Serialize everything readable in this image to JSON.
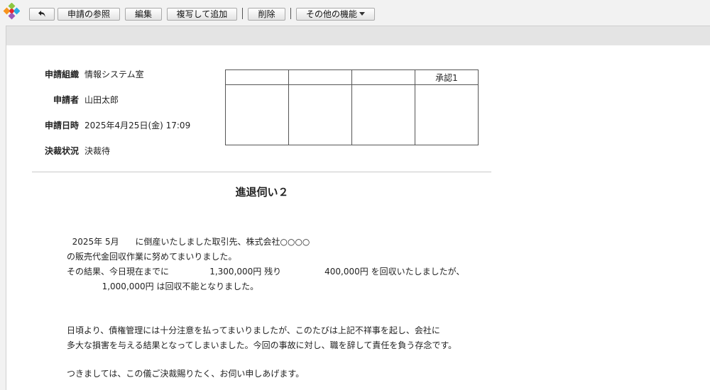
{
  "toolbar": {
    "buttons": {
      "reference": "申請の参照",
      "edit": "編集",
      "duplicate": "複写して追加",
      "delete": "削除",
      "other": "その他の機能"
    }
  },
  "application": {
    "fields": [
      {
        "label": "申請組織",
        "value": "情報システム室"
      },
      {
        "label": "申請者",
        "value": "山田太郎"
      },
      {
        "label": "申請日時",
        "value": "2025年4月25日(金) 17:09"
      },
      {
        "label": "決裁状況",
        "value": "決裁待"
      }
    ]
  },
  "approval_table": {
    "headers": [
      "",
      "",
      "",
      "承認1"
    ]
  },
  "document": {
    "title": "進退伺い２",
    "paragraph1": [
      "  2025年 5月      に倒産いたしました取引先、株式会社○○○○",
      "の販売代金回収作業に努めてまいりました。",
      "その結果、今日現在までに               1,300,000円 残り                400,000円 を回収いたしましたが、",
      "             1,000,000円 は回収不能となりました。"
    ],
    "paragraph2": [
      "日頃より、債権管理には十分注意を払ってまいりましたが、このたびは上記不祥事を起し、会社に",
      "多大な損害を与える結果となってしまいました。今回の事故に対し、職を辞して責任を負う存念です。"
    ],
    "paragraph3": "つきましては、この儀ご決裁賜りたく、お伺い申しあげます。"
  }
}
